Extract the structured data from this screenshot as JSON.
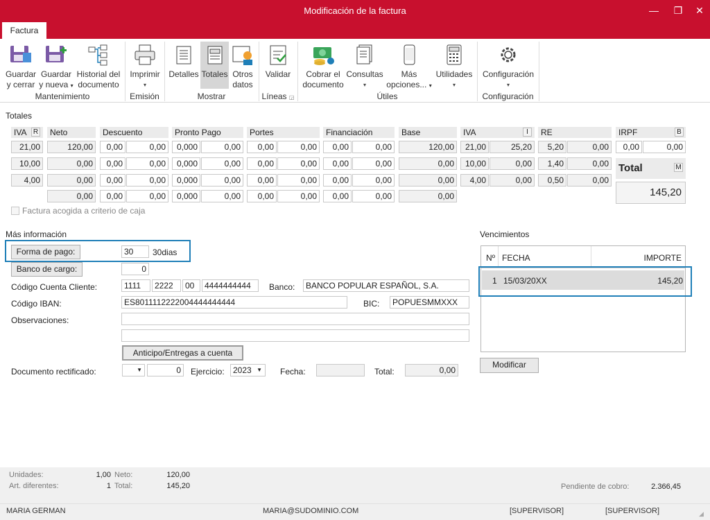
{
  "window": {
    "title": "Modificación de la factura",
    "min": "—",
    "max": "❐",
    "close": "✕"
  },
  "ribbon_tab": "Factura",
  "ribbon": {
    "guardar_cerrar": [
      "Guardar",
      "y cerrar"
    ],
    "guardar_nueva": [
      "Guardar",
      "y nueva"
    ],
    "historial": [
      "Historial del",
      "documento"
    ],
    "imprimir": "Imprimir",
    "detalles": "Detalles",
    "totales": "Totales",
    "otros": [
      "Otros",
      "datos"
    ],
    "validar": "Validar",
    "cobrar": [
      "Cobrar el",
      "documento"
    ],
    "consultas": "Consultas",
    "mas": [
      "Más",
      "opciones..."
    ],
    "utilidades": "Utilidades",
    "configuracion": "Configuración",
    "groups": {
      "mantenimiento": "Mantenimiento",
      "emision": "Emisión",
      "mostrar": "Mostrar",
      "lineas": "Líneas",
      "utiles": "Útiles",
      "configuracion": "Configuración"
    }
  },
  "totales": {
    "section": "Totales",
    "headers": {
      "iva": "IVA",
      "iva_btn": "R",
      "neto": "Neto",
      "descuento": "Descuento",
      "pronto": "Pronto Pago",
      "portes": "Portes",
      "financiacion": "Financiación",
      "base": "Base",
      "iva2": "IVA",
      "iva2_btn": "I",
      "re": "RE",
      "irpf": "IRPF",
      "irpf_btn": "B"
    },
    "rows": [
      {
        "iva": "21,00",
        "neto": "120,00",
        "desc_p": "0,00",
        "desc_v": "0,00",
        "pp_p": "0,000",
        "pp_v": "0,00",
        "port_p": "0,00",
        "port_v": "0,00",
        "fin_p": "0,00",
        "fin_v": "0,00",
        "base": "120,00",
        "iva_p": "21,00",
        "iva_v": "25,20",
        "re_p": "5,20",
        "re_v": "0,00"
      },
      {
        "iva": "10,00",
        "neto": "0,00",
        "desc_p": "0,00",
        "desc_v": "0,00",
        "pp_p": "0,000",
        "pp_v": "0,00",
        "port_p": "0,00",
        "port_v": "0,00",
        "fin_p": "0,00",
        "fin_v": "0,00",
        "base": "0,00",
        "iva_p": "10,00",
        "iva_v": "0,00",
        "re_p": "1,40",
        "re_v": "0,00"
      },
      {
        "iva": "4,00",
        "neto": "0,00",
        "desc_p": "0,00",
        "desc_v": "0,00",
        "pp_p": "0,000",
        "pp_v": "0,00",
        "port_p": "0,00",
        "port_v": "0,00",
        "fin_p": "0,00",
        "fin_v": "0,00",
        "base": "0,00",
        "iva_p": "4,00",
        "iva_v": "0,00",
        "re_p": "0,50",
        "re_v": "0,00"
      },
      {
        "iva": "",
        "neto": "0,00",
        "desc_p": "0,00",
        "desc_v": "0,00",
        "pp_p": "0,000",
        "pp_v": "0,00",
        "port_p": "0,00",
        "port_v": "0,00",
        "fin_p": "0,00",
        "fin_v": "0,00",
        "base": "0,00"
      }
    ],
    "irpf_p": "0,00",
    "irpf_v": "0,00",
    "total_label": "Total",
    "total_btn": "M",
    "total_value": "145,20",
    "caja_label": "Factura acogida a criterio de caja"
  },
  "info": {
    "section": "Más información",
    "forma_pago_btn": "Forma de pago:",
    "forma_pago_code": "30",
    "forma_pago_desc": "30dias",
    "banco_cargo_btn": "Banco de cargo:",
    "banco_cargo_val": "0",
    "ccc_label": "Código Cuenta Cliente:",
    "ccc": [
      "1111",
      "2222",
      "00",
      "4444444444"
    ],
    "banco_label": "Banco:",
    "banco_val": "BANCO POPULAR ESPAÑOL, S.A.",
    "iban_label": "Código IBAN:",
    "iban_val": "ES8011112222004444444444",
    "bic_label": "BIC:",
    "bic_val": "POPUESMMXXX",
    "obs_label": "Observaciones:",
    "anticipo_btn": "Anticipo/Entregas a cuenta",
    "doc_rect_label": "Documento rectificado:",
    "doc_rect_num": "0",
    "ejercicio_label": "Ejercicio:",
    "ejercicio_val": "2023",
    "fecha_label": "Fecha:",
    "total_label": "Total:",
    "total_val": "0,00"
  },
  "vencimientos": {
    "section": "Vencimientos",
    "cols": {
      "n": "Nº",
      "fecha": "FECHA",
      "importe": "IMPORTE"
    },
    "rows": [
      {
        "n": "1",
        "fecha": "15/03/20XX",
        "importe": "145,20"
      }
    ],
    "modificar_btn": "Modificar"
  },
  "footer": {
    "unidades_label": "Unidades:",
    "unidades_val": "1,00",
    "neto_label": "Neto:",
    "neto_val": "120,00",
    "art_label": "Art. diferentes:",
    "art_val": "1",
    "total_label": "Total:",
    "total_val": "145,20",
    "pendiente_label": "Pendiente de cobro:",
    "pendiente_val": "2.366,45"
  },
  "status": {
    "user": "MARIA GERMAN",
    "email": "MARIA@SUDOMINIO.COM",
    "role1": "[SUPERVISOR]",
    "role2": "[SUPERVISOR]"
  },
  "colors": {
    "accent": "#c8102e",
    "highlight": "#1f7fb8"
  }
}
